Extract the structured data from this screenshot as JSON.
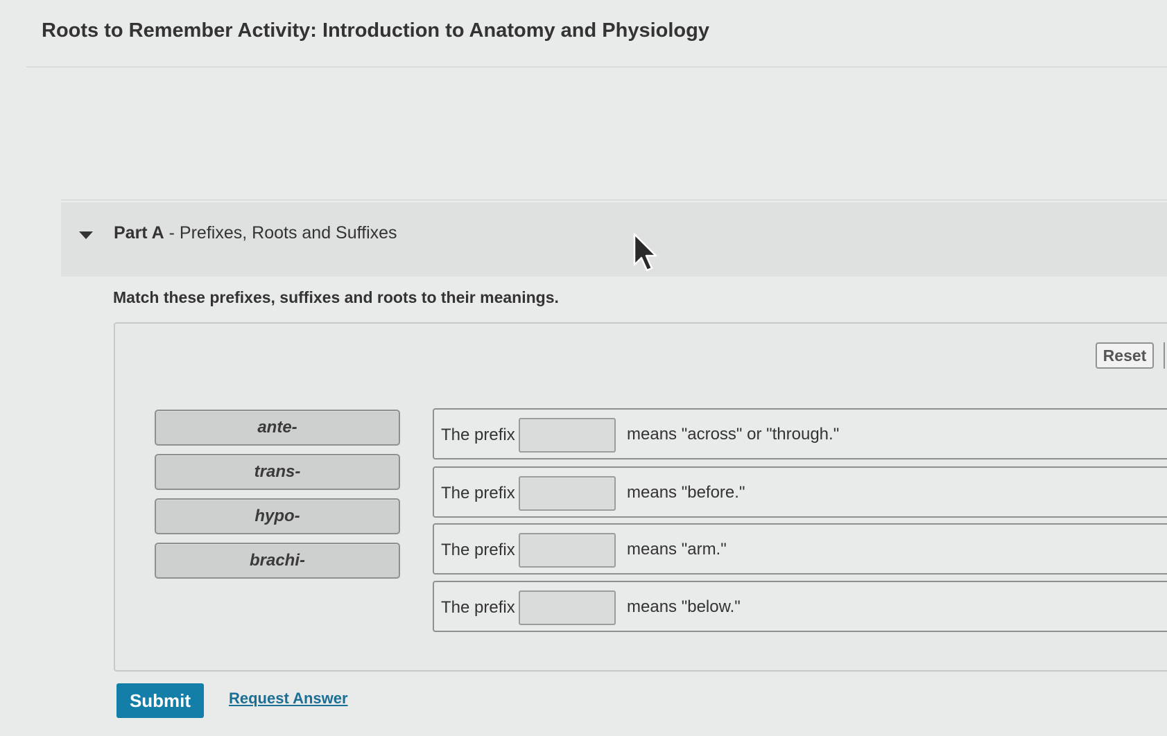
{
  "page": {
    "title": "Roots to Remember Activity: Introduction to Anatomy and Physiology"
  },
  "part": {
    "label_bold": "Part A",
    "label_rest": " - Prefixes, Roots and Suffixes",
    "expanded_icon": "caret-down-icon"
  },
  "instructions": "Match these prefixes, suffixes and roots to their meanings.",
  "toolbar": {
    "reset_label": "Reset"
  },
  "terms": [
    "ante-",
    "trans-",
    "hypo-",
    "brachi-"
  ],
  "statements": [
    {
      "prefix_text": "The prefix",
      "meaning": "means \"across\" or \"through.\"",
      "value": ""
    },
    {
      "prefix_text": "The prefix",
      "meaning": "means \"before.\"",
      "value": ""
    },
    {
      "prefix_text": "The prefix",
      "meaning": "means \"arm.\"",
      "value": ""
    },
    {
      "prefix_text": "The prefix",
      "meaning": "means \"below.\"",
      "value": ""
    }
  ],
  "actions": {
    "submit_label": "Submit",
    "request_answer_label": "Request Answer"
  },
  "colors": {
    "accent": "#137ea8",
    "link": "#1b6f95",
    "background": "#e9ebea"
  },
  "cursor_icon": "mouse-pointer-icon"
}
